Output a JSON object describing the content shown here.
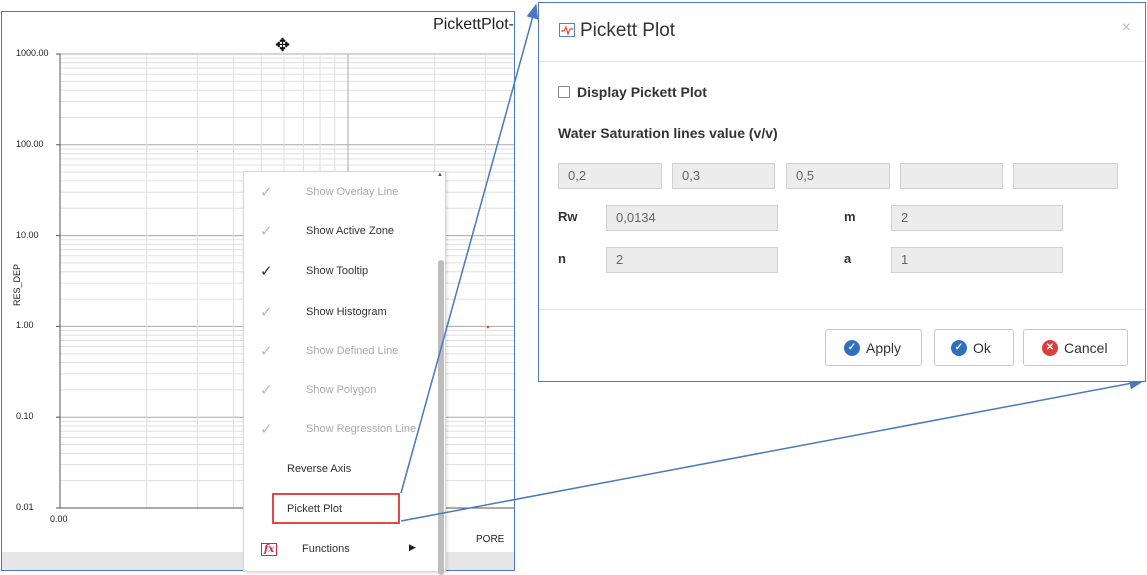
{
  "plot": {
    "title": "PickettPlot-",
    "y_axis_label": "RES_DEP",
    "y_ticks": [
      "1000.00",
      "100.00",
      "10.00",
      "1.00",
      "0.10",
      "0.01"
    ],
    "x_tick_start": "0.00",
    "x_axis_label": "PORE"
  },
  "context_menu": {
    "items": [
      {
        "label": "Show Overlay Line",
        "checked": false
      },
      {
        "label": "Show Active Zone",
        "checked": false
      },
      {
        "label": "Show Tooltip",
        "checked": true
      },
      {
        "label": "Show Histogram",
        "checked": false
      },
      {
        "label": "Show Defined Line",
        "checked": false
      },
      {
        "label": "Show Polygon",
        "checked": false
      },
      {
        "label": "Show Regression Line",
        "checked": false
      }
    ],
    "reverse_axis": "Reverse Axis",
    "pickett_plot": "Pickett Plot",
    "functions": "Functions",
    "functions_icon": "fx"
  },
  "dialog": {
    "title": "Pickett Plot",
    "close_glyph": "×",
    "display_checkbox_label": "Display Pickett Plot",
    "ws_label": "Water Saturation lines value (v/v)",
    "ws_values": [
      "0,2",
      "0,3",
      "0,5",
      "",
      ""
    ],
    "rw_label": "Rw",
    "rw_value": "0,0134",
    "m_label": "m",
    "m_value": "2",
    "n_label": "n",
    "n_value": "2",
    "a_label": "a",
    "a_value": "1",
    "buttons": {
      "apply": "Apply",
      "ok": "Ok",
      "cancel": "Cancel"
    }
  },
  "colors": {
    "accent": "#4a78c2",
    "highlight": "#e04848",
    "cancel": "#e03c3c",
    "ok": "#2f6fc0"
  }
}
